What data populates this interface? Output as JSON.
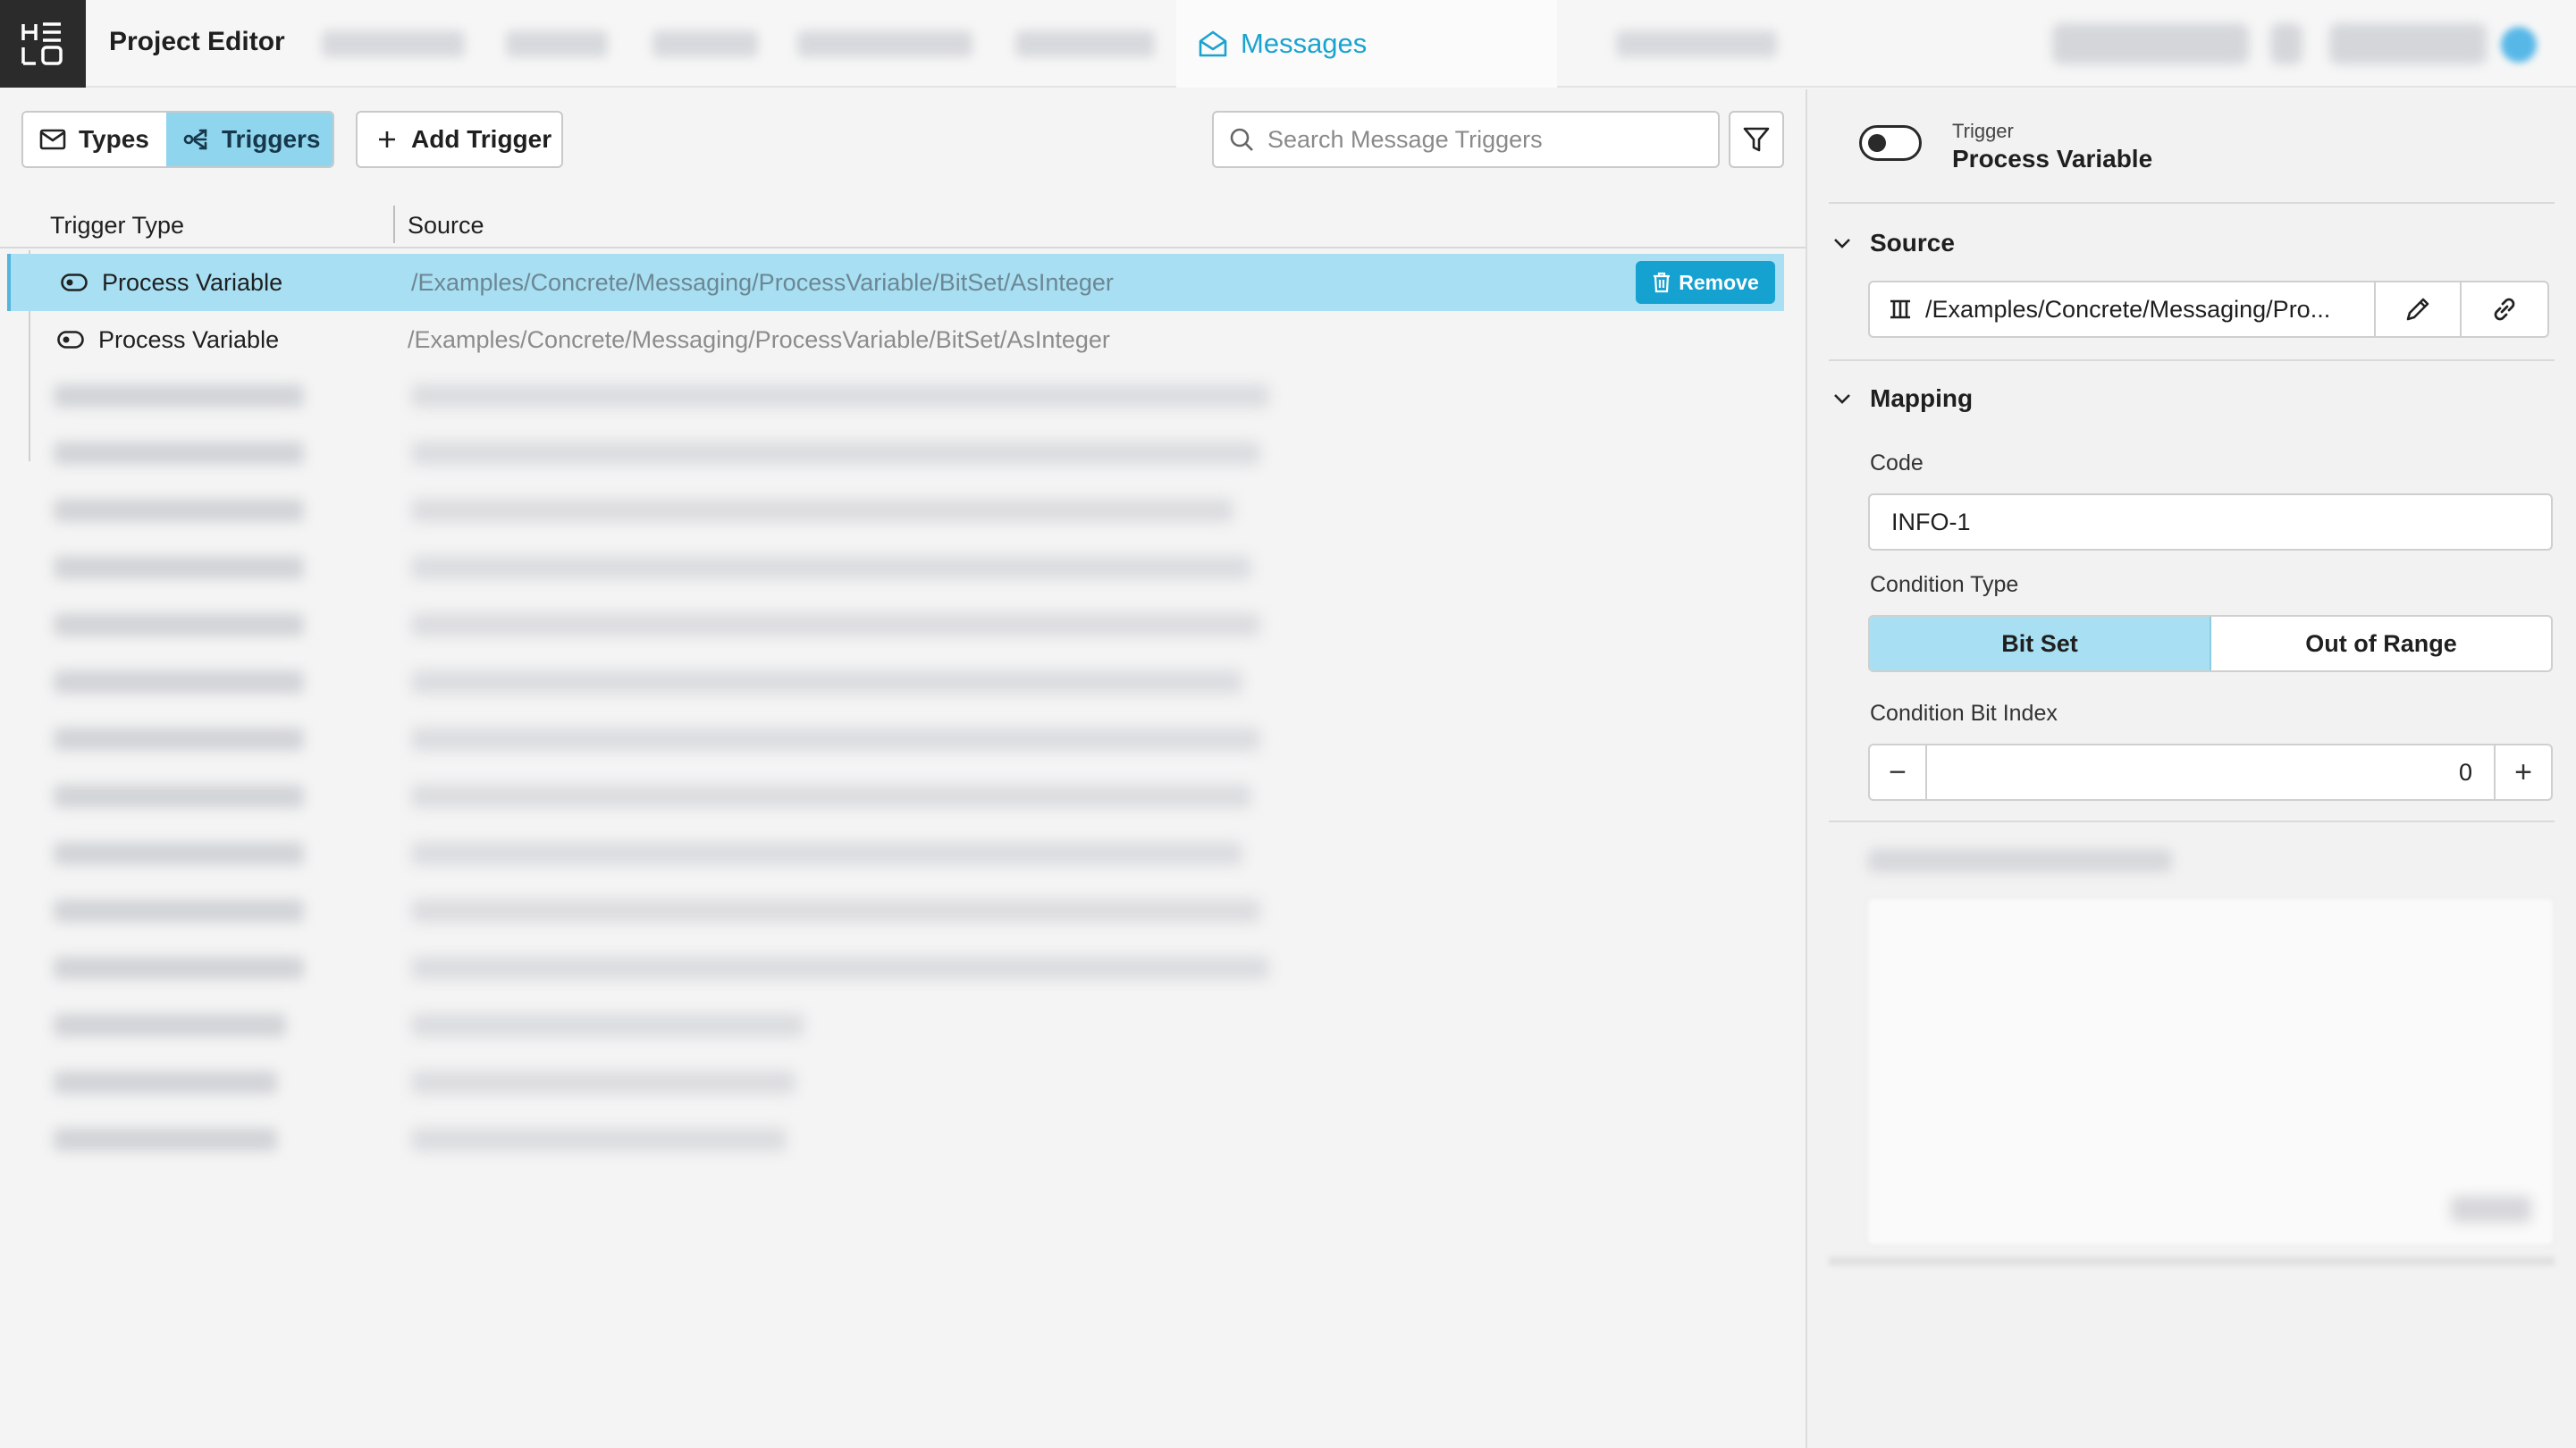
{
  "app": {
    "logo_text": "HELO",
    "title": "Project Editor",
    "active_tab": "Messages"
  },
  "toolbar": {
    "types_label": "Types",
    "triggers_label": "Triggers",
    "add_trigger_label": "Add Trigger",
    "search_placeholder": "Search Message Triggers"
  },
  "table": {
    "columns": [
      "Trigger Type",
      "Source"
    ],
    "rows": [
      {
        "type": "Process Variable",
        "source": "/Examples/Concrete/Messaging/ProcessVariable/BitSet/AsInteger",
        "selected": true
      },
      {
        "type": "Process Variable",
        "source": "/Examples/Concrete/Messaging/ProcessVariable/BitSet/AsInteger",
        "selected": false
      }
    ],
    "remove_label": "Remove"
  },
  "detail": {
    "trigger_caption": "Trigger",
    "trigger_name": "Process Variable",
    "source_section": "Source",
    "source_path": "/Examples/Concrete/Messaging/Pro...",
    "mapping_section": "Mapping",
    "code_label": "Code",
    "code_value": "INFO-1",
    "condition_type_label": "Condition Type",
    "condition_options": [
      "Bit Set",
      "Out of Range"
    ],
    "condition_selected": "Bit Set",
    "bit_index_label": "Condition Bit Index",
    "bit_index_value": "0",
    "minus_symbol": "−",
    "plus_symbol": "+"
  },
  "colors": {
    "accent": "#16a2d1",
    "selected_row": "#a8dff2",
    "active_segment": "#8fd5ee"
  }
}
